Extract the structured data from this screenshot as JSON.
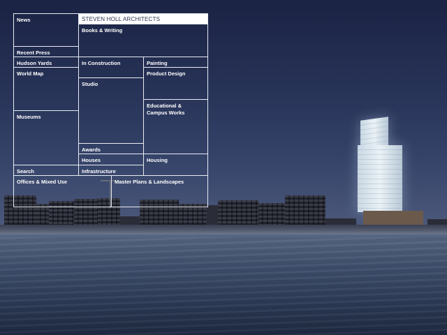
{
  "title": "STEVEN HOLL ARCHITECTS",
  "nav": {
    "news": "News",
    "recent_press": "Recent Press",
    "hudson_yards": "Hudson Yards",
    "world_map": "World Map",
    "museums": "Museums",
    "search": "Search",
    "offices_mixed_use": "Offices & Mixed Use",
    "books_writing": "Books & Writing",
    "in_construction": "In Construction",
    "studio": "Studio",
    "awards": "Awards",
    "houses": "Houses",
    "infrastructure": "Infrastructure",
    "master_plans": "Master Plans & Landscapes",
    "painting": "Painting",
    "product_design": "Product Design",
    "educational": "Educational & Campus Works",
    "housing": "Housing"
  },
  "colors": {
    "grid_line": "#e8ecf2",
    "title_bg": "#ffffff",
    "title_text": "#2a3350",
    "sky": "#273357",
    "sea": "#3f4f6c"
  }
}
